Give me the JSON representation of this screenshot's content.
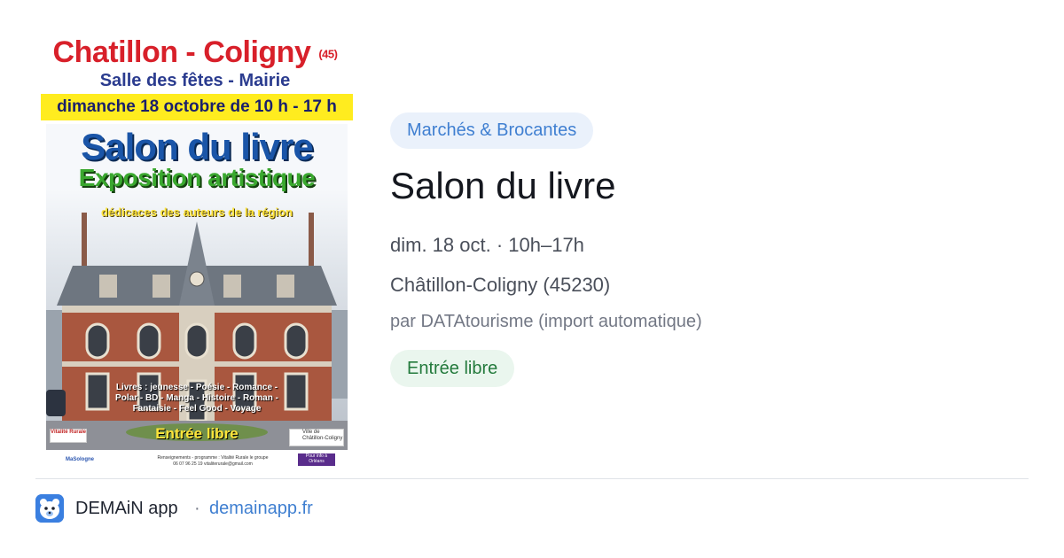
{
  "poster": {
    "town": "Chatillon - Coligny",
    "dept": "(45)",
    "venue": "Salle des fêtes - Mairie",
    "date_line": "dimanche 18 octobre de 10 h - 17 h",
    "big_title": "Salon du livre",
    "subtitle": "Exposition artistique",
    "dedication": "dédicaces des auteurs de la région",
    "genres": "Livres : jeunesse - Poésie - Romance -\nPolar - BD - Manga - Histoire - Roman -\nFantaisie - Feel Good - Voyage",
    "free_entry": "Entrée libre",
    "logo_left": "Vitalité Rurale",
    "logo_right": "Ville de Châtillon-Coligny",
    "fb_tag": "MaSologne",
    "contact_line": "Renseignements - programme : Vitalité Rurale le groupe\n06 07 96 25 19 vitaliterurale@gmail.com",
    "orleans_tag": "Pour info à Orléans"
  },
  "event": {
    "category": "Marchés & Brocantes",
    "title": "Salon du livre",
    "date_time": "dim. 18 oct. · 10h–17h",
    "location": "Châtillon-Coligny (45230)",
    "organizer": "par DATAtourisme (import automatique)",
    "price": "Entrée libre"
  },
  "footer": {
    "app_name": "DEMAiN app",
    "separator": "·",
    "link": "demainapp.fr",
    "icon": "bear-app-icon"
  },
  "colors": {
    "accent_blue": "#3f7fd1",
    "pill_blue_bg": "#eaf1fb",
    "pill_green_bg": "#eaf6ee",
    "pill_green_text": "#237a3c"
  }
}
